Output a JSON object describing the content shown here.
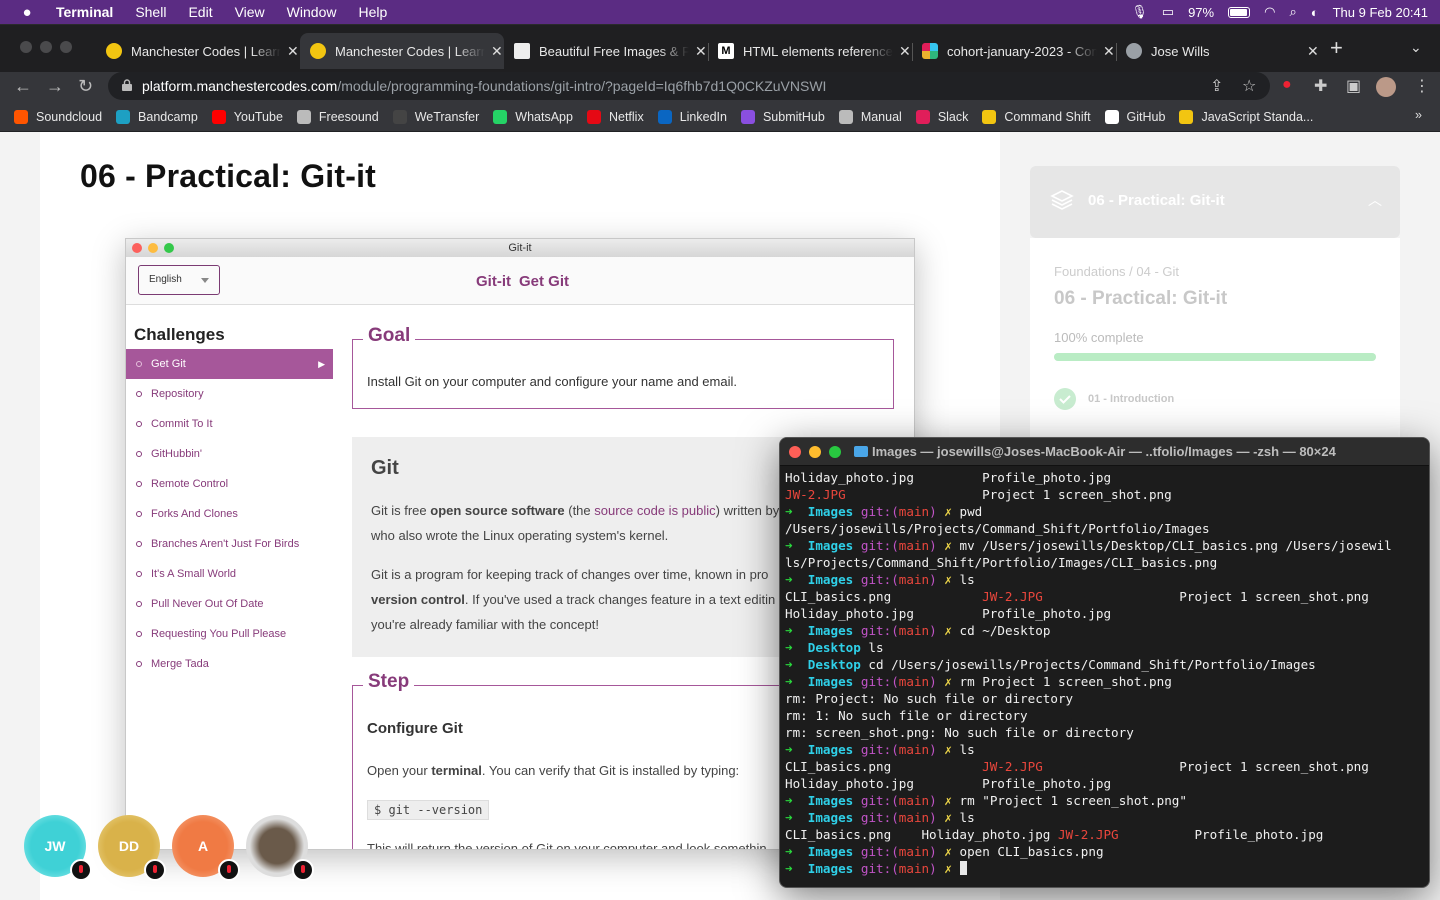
{
  "menubar": {
    "app": "Terminal",
    "items": [
      "Shell",
      "Edit",
      "View",
      "Window",
      "Help"
    ],
    "battery": "97%",
    "datetime": "Thu 9 Feb  20:41"
  },
  "tabs": [
    {
      "title": "Manchester Codes | Learn",
      "color": "#f2c511",
      "active": false
    },
    {
      "title": "Manchester Codes | Learn",
      "color": "#f2c511",
      "active": true
    },
    {
      "title": "Beautiful Free Images & Pictures",
      "color": "#111111",
      "active": false
    },
    {
      "title": "HTML elements reference",
      "color": "#000000",
      "active": false
    },
    {
      "title": "cohort-january-2023 - Command",
      "color": "#e01e5a",
      "active": false
    },
    {
      "title": "Jose Wills",
      "color": "#9aa0a6",
      "active": false
    }
  ],
  "address": {
    "host": "platform.manchestercodes.com",
    "path": "/module/programming-foundations/git-intro/?pageId=Iq6fhb7d1Q0CKZuVNSWI"
  },
  "bookmarks": [
    {
      "label": "Soundcloud",
      "color": "#ff5500"
    },
    {
      "label": "Bandcamp",
      "color": "#1da0c3"
    },
    {
      "label": "YouTube",
      "color": "#ff0000"
    },
    {
      "label": "Freesound",
      "color": "#bbbbbb"
    },
    {
      "label": "WeTransfer",
      "color": "#444444"
    },
    {
      "label": "WhatsApp",
      "color": "#25d366"
    },
    {
      "label": "Netflix",
      "color": "#e50914"
    },
    {
      "label": "LinkedIn",
      "color": "#0a66c2"
    },
    {
      "label": "SubmitHub",
      "color": "#8a4fe0"
    },
    {
      "label": "Manual",
      "color": "#bbbbbb"
    },
    {
      "label": "Slack",
      "color": "#e01e5a"
    },
    {
      "label": "Command Shift",
      "color": "#f2c511"
    },
    {
      "label": "GitHub",
      "color": "#ffffff"
    },
    {
      "label": "JavaScript Standa...",
      "color": "#f2c511"
    }
  ],
  "page": {
    "title": "06 - Practical: Git-it"
  },
  "gitit": {
    "window_title": "Git-it",
    "language": "English",
    "nav": [
      "Git-it",
      "Get Git"
    ],
    "challenges_heading": "Challenges",
    "challenges": [
      "Get Git",
      "Repository",
      "Commit To It",
      "GitHubbin'",
      "Remote Control",
      "Forks And Clones",
      "Branches Aren't Just For Birds",
      "It's A Small World",
      "Pull Never Out Of Date",
      "Requesting You Pull Please",
      "Merge Tada"
    ],
    "goal_legend": "Goal",
    "goal_text": "Install Git on your computer and configure your name and email.",
    "git_heading": "Git",
    "p1a": "Git is free ",
    "p1b": "open source software",
    "p1c": " (the ",
    "p1d": "source code is public",
    "p1e": ") written by",
    "p1f": "who also wrote the Linux operating system's kernel.",
    "p2a": "Git is a program for keeping track of changes over time, known in pro",
    "p2b": "version control",
    "p2c": ". If you've used a track changes feature in a text editin",
    "p2d": "you're already familiar with the concept!",
    "step_legend": "Step",
    "step_subheading": "Configure Git",
    "step_text_a": "Open your ",
    "step_text_b": "terminal",
    "step_text_c": ". You can verify that Git is installed by typing:",
    "code": "$ git --version",
    "step_more": "This will return the version of Git on your computer and look somethin"
  },
  "sidebar": {
    "header": "06 - Practical: Git-it",
    "breadcrumb": "Foundations / 04 - Git",
    "title": "06 - Practical: Git-it",
    "progress_text": "100% complete",
    "progress": 1.0,
    "lesson": "01 - Introduction"
  },
  "participants": [
    {
      "initials": "JW",
      "color": "#33c6cc"
    },
    {
      "initials": "DD",
      "color": "#d9b24a"
    },
    {
      "initials": "A",
      "color": "#f07a44"
    },
    {
      "initials": "",
      "color": "#555555"
    }
  ],
  "terminal": {
    "title": "Images — josewills@Joses-MacBook-Air — ..tfolio/Images — -zsh — 80×24",
    "lines": [
      "Holiday_photo.jpg         Profile_photo.jpg",
      "JW-2.JPG                  Project 1 screen_shot.png",
      "➜  Images git:(main) ✗ pwd",
      "/Users/josewills/Projects/Command_Shift/Portfolio/Images",
      "➜  Images git:(main) ✗ mv /Users/josewills/Desktop/CLI_basics.png /Users/josewil",
      "ls/Projects/Command_Shift/Portfolio/Images/CLI_basics.png",
      "➜  Images git:(main) ✗ ls",
      "CLI_basics.png            JW-2.JPG                  Project 1 screen_shot.png",
      "Holiday_photo.jpg         Profile_photo.jpg",
      "➜  Images git:(main) ✗ cd ~/Desktop",
      "➜  Desktop ls",
      "➜  Desktop cd /Users/josewills/Projects/Command_Shift/Portfolio/Images",
      "➜  Images git:(main) ✗ rm Project 1 screen_shot.png",
      "rm: Project: No such file or directory",
      "rm: 1: No such file or directory",
      "rm: screen_shot.png: No such file or directory",
      "➜  Images git:(main) ✗ ls",
      "CLI_basics.png            JW-2.JPG                  Project 1 screen_shot.png",
      "Holiday_photo.jpg         Profile_photo.jpg",
      "➜  Images git:(main) ✗ rm \"Project 1 screen_shot.png\"",
      "➜  Images git:(main) ✗ ls",
      "CLI_basics.png    Holiday_photo.jpg JW-2.JPG          Profile_photo.jpg",
      "➜  Images git:(main) ✗ open CLI_basics.png",
      "➜  Images git:(main) ✗ "
    ]
  }
}
